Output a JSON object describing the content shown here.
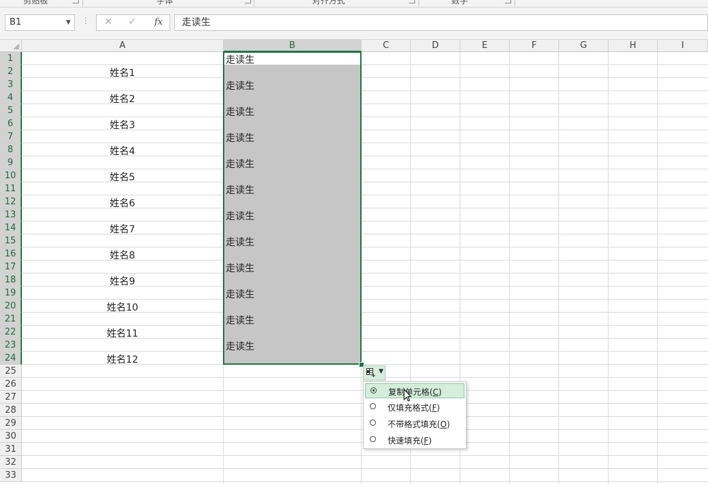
{
  "ribbon": {
    "groups": [
      "剪贴板",
      "字体",
      "对齐方式",
      "数字"
    ]
  },
  "formula_bar": {
    "name_box": "B1",
    "cancel_icon": "✕",
    "enter_icon": "✓",
    "fx_label": "fx",
    "formula": "走读生"
  },
  "columns": [
    "A",
    "B",
    "C",
    "D",
    "E",
    "F",
    "G",
    "H",
    "I"
  ],
  "selected_column": "B",
  "rows": [
    "1",
    "2",
    "3",
    "4",
    "5",
    "6",
    "7",
    "8",
    "9",
    "10",
    "11",
    "12",
    "13",
    "14",
    "15",
    "16",
    "17",
    "18",
    "19",
    "20",
    "21",
    "22",
    "23",
    "24",
    "25",
    "26",
    "27",
    "28",
    "29",
    "30",
    "31",
    "32",
    "33"
  ],
  "column_a_values": [
    "姓名1",
    "姓名2",
    "姓名3",
    "姓名4",
    "姓名5",
    "姓名6",
    "姓名7",
    "姓名8",
    "姓名9",
    "姓名10",
    "姓名11",
    "姓名12"
  ],
  "column_b_values": [
    "走读生",
    "走读生",
    "走读生",
    "走读生",
    "走读生",
    "走读生",
    "走读生",
    "走读生",
    "走读生",
    "走读生",
    "走读生",
    "走读生"
  ],
  "autofill": {
    "button_icon": "auto-fill-options-icon",
    "options": [
      {
        "label": "复制单元格",
        "key": "C",
        "selected": true
      },
      {
        "label": "仅填充格式",
        "key": "F",
        "selected": false
      },
      {
        "label": "不带格式填充",
        "key": "O",
        "selected": false
      },
      {
        "label": "快速填充",
        "key": "F",
        "selected": false
      }
    ]
  },
  "colors": {
    "accent": "#217346",
    "selection_fill": "#c6c6c6",
    "menu_highlight": "#d3eeda"
  }
}
